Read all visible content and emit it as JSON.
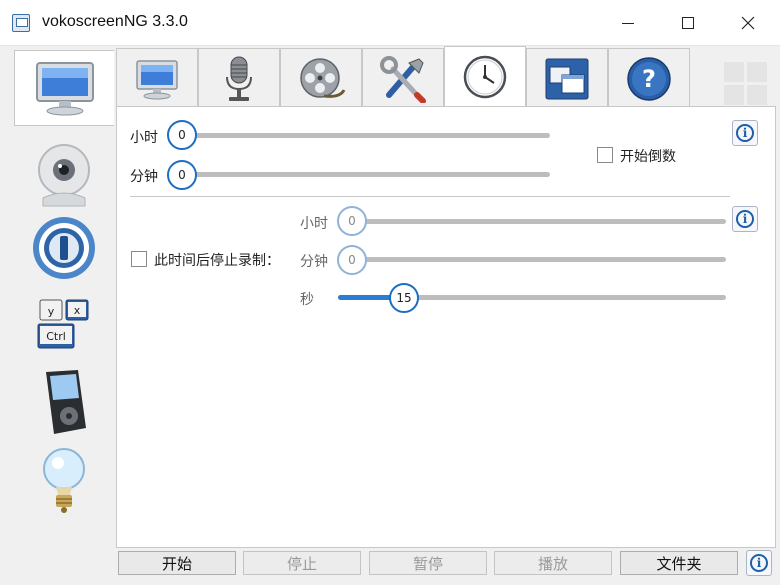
{
  "window": {
    "title": "vokoscreenNG 3.3.0"
  },
  "sidebar": {
    "items": [
      {
        "name": "screen",
        "icon": "monitor-icon",
        "active": true
      },
      {
        "name": "webcam",
        "icon": "webcam-icon"
      },
      {
        "name": "player",
        "icon": "player-circle-icon"
      },
      {
        "name": "shortcuts",
        "icon": "keyboard-shortcut-icon",
        "keys": [
          "y",
          "x",
          "Ctrl"
        ]
      },
      {
        "name": "media-player",
        "icon": "media-player-icon"
      },
      {
        "name": "log",
        "icon": "lightbulb-icon"
      }
    ]
  },
  "tabs": [
    {
      "name": "screen",
      "icon": "monitor-icon"
    },
    {
      "name": "audio",
      "icon": "microphone-icon"
    },
    {
      "name": "video",
      "icon": "film-reel-icon"
    },
    {
      "name": "misc",
      "icon": "tools-icon"
    },
    {
      "name": "timer",
      "icon": "clock-icon",
      "active": true
    },
    {
      "name": "windows",
      "icon": "windows-icon"
    },
    {
      "name": "help",
      "icon": "help-icon",
      "label": "?"
    }
  ],
  "countdown": {
    "hours_label": "小时",
    "hours_value": "0",
    "minutes_label": "分钟",
    "minutes_value": "0",
    "start_countdown_label": "开始倒数",
    "info_label": "i"
  },
  "stop_after": {
    "checkbox_label": "此时间后停止录制：",
    "hours_label": "小时",
    "hours_value": "0",
    "minutes_label": "分钟",
    "minutes_value": "0",
    "seconds_label": "秒",
    "seconds_value": "15",
    "info_label": "i"
  },
  "buttons": {
    "start": "开始",
    "stop": "停止",
    "pause": "暂停",
    "play": "播放",
    "folder": "文件夹",
    "info": "i"
  },
  "colors": {
    "accent": "#1d6ec2",
    "slider_fill": "#2b7cd3",
    "track": "#bdbdbd"
  }
}
